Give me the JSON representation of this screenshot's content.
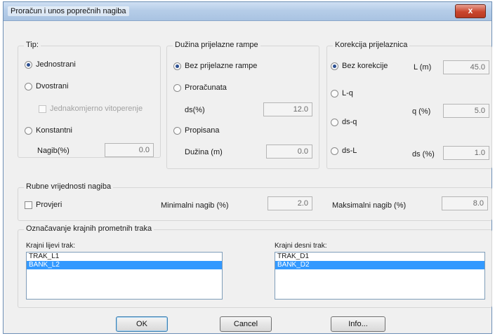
{
  "window": {
    "title": "Proračun i unos poprečnih nagiba",
    "close_glyph": "x"
  },
  "tip": {
    "legend": "Tip:",
    "options": [
      "Jednostrani",
      "Dvostrani",
      "Konstantni"
    ],
    "selected": "Jednostrani",
    "checkbox_label": "Jednakomjerno vitoperenje",
    "nagib_label": "Nagib(%)",
    "nagib_value": "0.0"
  },
  "duzina": {
    "legend": "Dužina prijelazne rampe",
    "options": [
      "Bez prijelazne rampe",
      "Proračunata",
      "Propisana"
    ],
    "selected": "Bez prijelazne rampe",
    "ds_label": "ds(%)",
    "ds_value": "12.0",
    "duzina_label": "Dužina (m)",
    "duzina_value": "0.0"
  },
  "korekcija": {
    "legend": "Korekcija prijelaznica",
    "options": [
      "Bez korekcije",
      "L-q",
      "ds-q",
      "ds-L"
    ],
    "selected": "Bez korekcije",
    "l_label": "L (m)",
    "l_value": "45.0",
    "q_label": "q (%)",
    "q_value": "5.0",
    "ds_label": "ds (%)",
    "ds_value": "1.0"
  },
  "rubne": {
    "legend": "Rubne vrijednosti nagiba",
    "check_label": "Provjeri",
    "min_label": "Minimalni nagib (%)",
    "min_value": "2.0",
    "max_label": "Maksimalni nagib (%)",
    "max_value": "8.0"
  },
  "oznacavanje": {
    "legend": "Označavanje krajnih prometnih traka",
    "left_label": "Krajni lijevi trak:",
    "left_items": [
      "TRAK_L1",
      "BANK_L2"
    ],
    "left_selected": "BANK_L2",
    "right_label": "Krajni desni trak:",
    "right_items": [
      "TRAK_D1",
      "BANK_D2"
    ],
    "right_selected": "BANK_D2"
  },
  "buttons": {
    "ok": "OK",
    "cancel": "Cancel",
    "info": "Info..."
  }
}
